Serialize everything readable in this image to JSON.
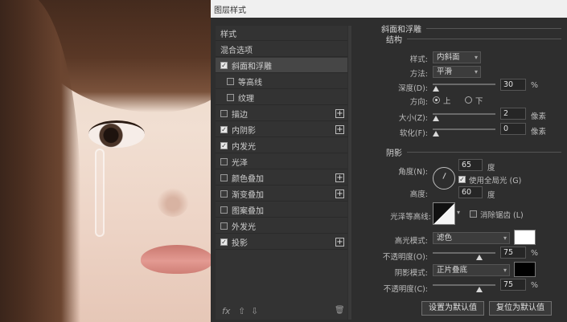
{
  "dialog": {
    "title": "图层样式"
  },
  "style_list": {
    "items": [
      {
        "label": "样式",
        "checkbox": false,
        "checked": false,
        "plus": false,
        "sub": false,
        "selected": false
      },
      {
        "label": "混合选项",
        "checkbox": false,
        "checked": false,
        "plus": false,
        "sub": false,
        "selected": false
      },
      {
        "label": "斜面和浮雕",
        "checkbox": true,
        "checked": true,
        "plus": false,
        "sub": false,
        "selected": true
      },
      {
        "label": "等高线",
        "checkbox": true,
        "checked": false,
        "plus": false,
        "sub": true,
        "selected": false
      },
      {
        "label": "纹理",
        "checkbox": true,
        "checked": false,
        "plus": false,
        "sub": true,
        "selected": false
      },
      {
        "label": "描边",
        "checkbox": true,
        "checked": false,
        "plus": true,
        "sub": false,
        "selected": false
      },
      {
        "label": "内阴影",
        "checkbox": true,
        "checked": true,
        "plus": true,
        "sub": false,
        "selected": false
      },
      {
        "label": "内发光",
        "checkbox": true,
        "checked": true,
        "plus": false,
        "sub": false,
        "selected": false
      },
      {
        "label": "光泽",
        "checkbox": true,
        "checked": false,
        "plus": false,
        "sub": false,
        "selected": false
      },
      {
        "label": "颜色叠加",
        "checkbox": true,
        "checked": false,
        "plus": true,
        "sub": false,
        "selected": false
      },
      {
        "label": "渐变叠加",
        "checkbox": true,
        "checked": false,
        "plus": true,
        "sub": false,
        "selected": false
      },
      {
        "label": "图案叠加",
        "checkbox": true,
        "checked": false,
        "plus": false,
        "sub": false,
        "selected": false
      },
      {
        "label": "外发光",
        "checkbox": true,
        "checked": false,
        "plus": false,
        "sub": false,
        "selected": false
      },
      {
        "label": "投影",
        "checkbox": true,
        "checked": true,
        "plus": true,
        "sub": false,
        "selected": false
      }
    ],
    "bottom_icons": {
      "fx": "fx",
      "up": "⇧",
      "down": "⇩",
      "trash": "🗑"
    }
  },
  "bevel": {
    "title": "斜面和浮雕",
    "structure_title": "结构",
    "style_label": "样式:",
    "style_value": "内斜面",
    "method_label": "方法:",
    "method_value": "平滑",
    "depth_label": "深度(D):",
    "depth_value": "30",
    "depth_unit": "%",
    "depth_fraction": 0.03,
    "direction_label": "方向:",
    "direction_up": "上",
    "direction_down": "下",
    "size_label": "大小(Z):",
    "size_value": "2",
    "size_unit": "像素",
    "soften_label": "软化(F):",
    "soften_value": "0",
    "soften_unit": "像素"
  },
  "shading": {
    "title": "阴影",
    "angle_label": "角度(N):",
    "angle_value": "65",
    "angle_unit": "度",
    "global_light_label": "使用全局光 (G)",
    "altitude_label": "高度:",
    "altitude_value": "60",
    "altitude_unit": "度",
    "gloss_contour_label": "光泽等高线:",
    "antialias_label": "消除锯齿 (L)",
    "highlight_mode_label": "高光模式:",
    "highlight_mode_value": "滤色",
    "highlight_color": "#ffffff",
    "highlight_opacity_label": "不透明度(O):",
    "highlight_opacity_value": "75",
    "highlight_opacity_unit": "%",
    "shadow_mode_label": "阴影模式:",
    "shadow_mode_value": "正片叠底",
    "shadow_color": "#000000",
    "shadow_opacity_label": "不透明度(C):",
    "shadow_opacity_value": "75",
    "shadow_opacity_unit": "%"
  },
  "buttons": {
    "set_default": "设置为默认值",
    "reset_default": "复位为默认值"
  }
}
